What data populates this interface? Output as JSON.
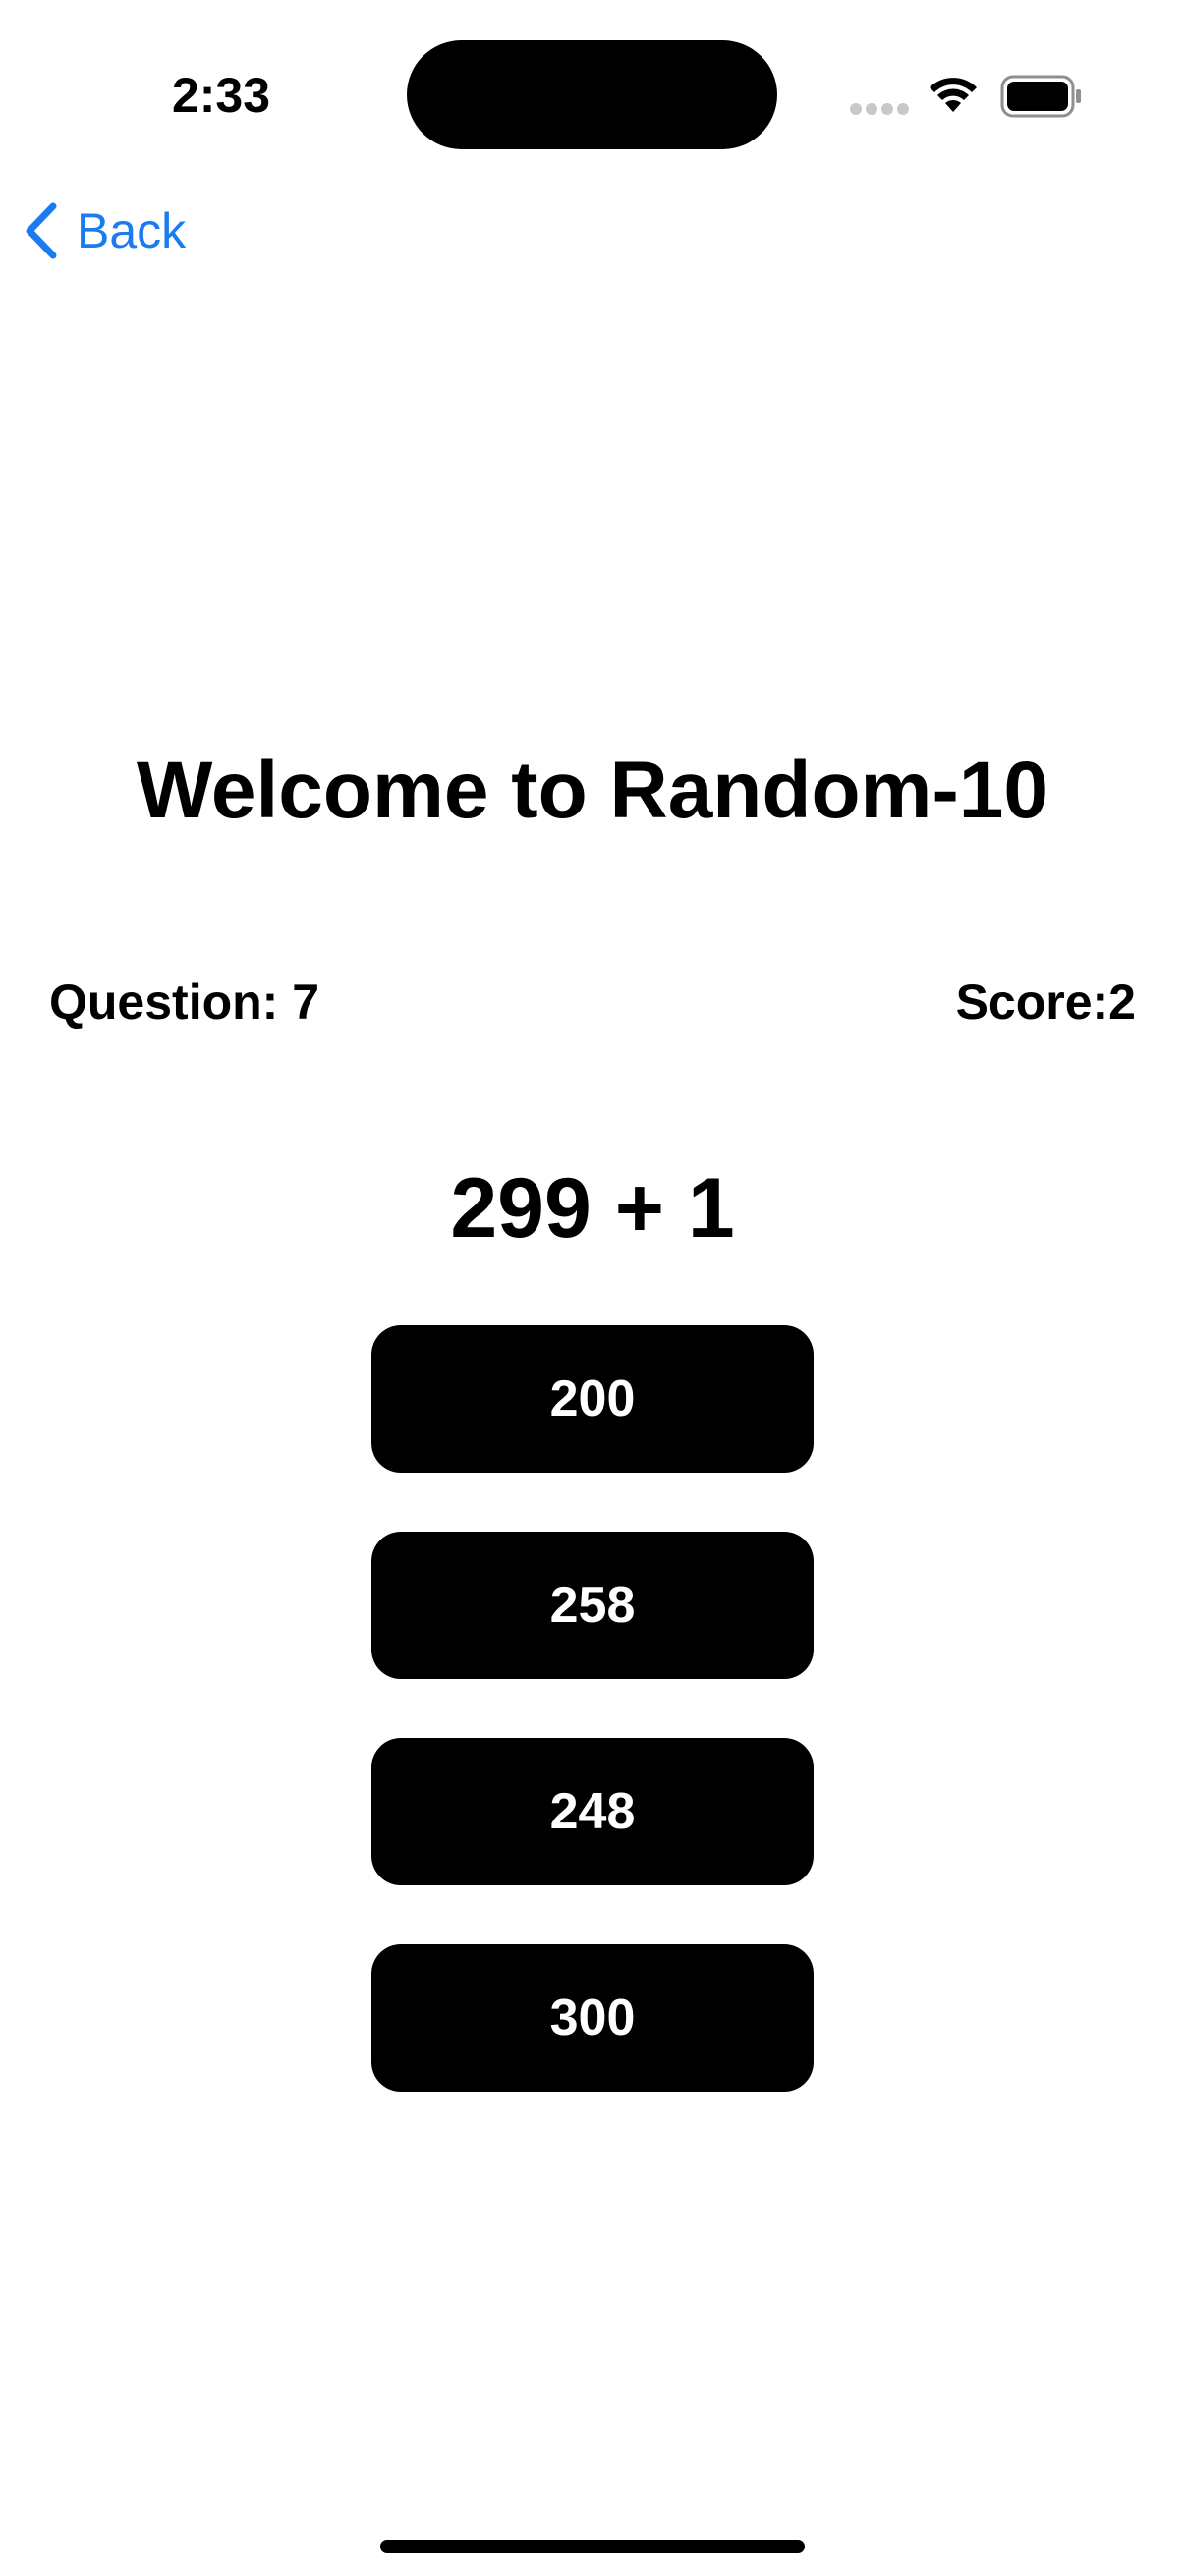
{
  "status_bar": {
    "time": "2:33"
  },
  "nav": {
    "back_label": "Back",
    "accent_color": "#1a7cf0"
  },
  "game": {
    "title": "Welcome to Random-10",
    "question_label": "Question: 7",
    "score_label": "Score:2",
    "problem": "299 + 1",
    "answers": [
      {
        "label": "200"
      },
      {
        "label": "258"
      },
      {
        "label": "248"
      },
      {
        "label": "300"
      }
    ]
  },
  "icons": {
    "back": "chevron-left-icon",
    "signal": "signal-dots-icon",
    "wifi": "wifi-icon",
    "battery": "battery-icon"
  }
}
